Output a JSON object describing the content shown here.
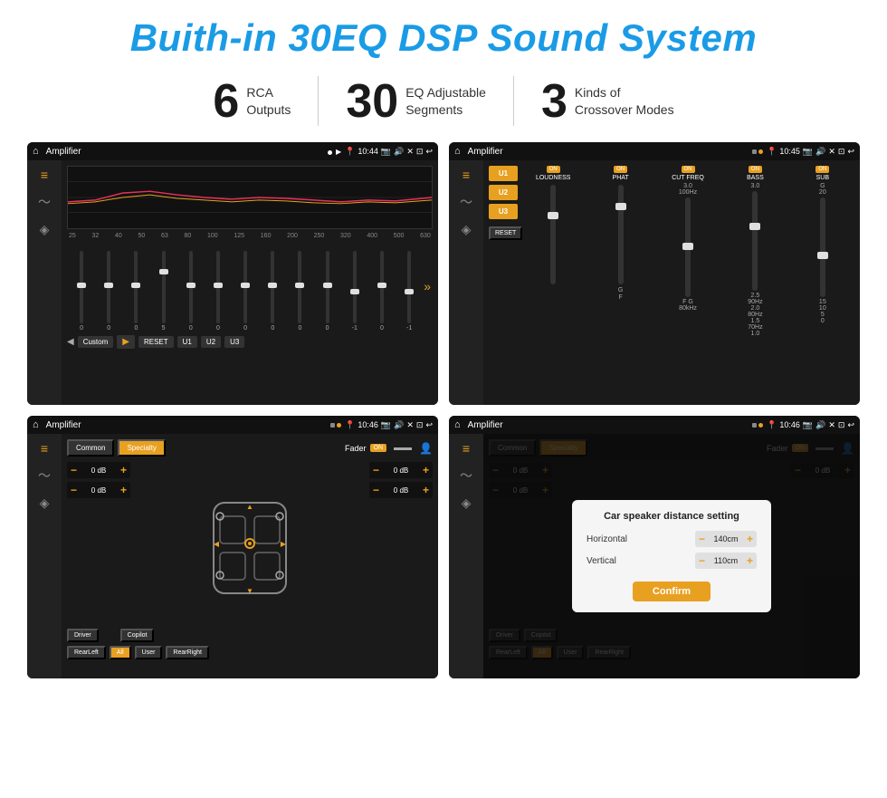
{
  "page": {
    "title": "Buith-in 30EQ DSP Sound System",
    "stats": [
      {
        "number": "6",
        "text_line1": "RCA",
        "text_line2": "Outputs"
      },
      {
        "number": "30",
        "text_line1": "EQ Adjustable",
        "text_line2": "Segments"
      },
      {
        "number": "3",
        "text_line1": "Kinds of",
        "text_line2": "Crossover Modes"
      }
    ]
  },
  "screen1": {
    "title": "Amplifier",
    "time": "10:44",
    "eq_freqs": [
      "25",
      "32",
      "40",
      "50",
      "63",
      "80",
      "100",
      "125",
      "160",
      "200",
      "250",
      "320",
      "400",
      "500",
      "630"
    ],
    "eq_values": [
      "0",
      "0",
      "0",
      "5",
      "0",
      "0",
      "0",
      "0",
      "0",
      "0",
      "-1",
      "0",
      "-1"
    ],
    "eq_mode": "Custom",
    "buttons": [
      "RESET",
      "U1",
      "U2",
      "U3"
    ]
  },
  "screen2": {
    "title": "Amplifier",
    "time": "10:45",
    "presets": [
      "U1",
      "U2",
      "U3"
    ],
    "channels": [
      "LOUDNESS",
      "PHAT",
      "CUT FREQ",
      "BASS",
      "SUB"
    ],
    "on_labels": [
      "ON",
      "ON",
      "ON",
      "ON",
      "ON"
    ],
    "reset_label": "RESET"
  },
  "screen3": {
    "title": "Amplifier",
    "time": "10:46",
    "tabs": [
      "Common",
      "Specialty"
    ],
    "active_tab": "Specialty",
    "fader_label": "Fader",
    "on_label": "ON",
    "db_values": [
      "0 dB",
      "0 dB",
      "0 dB",
      "0 dB"
    ],
    "bottom_buttons": [
      "Driver",
      "",
      "Copilot",
      "RearLeft",
      "All",
      "User",
      "RearRight"
    ]
  },
  "screen4": {
    "title": "Amplifier",
    "time": "10:46",
    "tabs": [
      "Common",
      "Specialty"
    ],
    "dialog": {
      "title": "Car speaker distance setting",
      "horizontal_label": "Horizontal",
      "horizontal_value": "140cm",
      "vertical_label": "Vertical",
      "vertical_value": "110cm",
      "confirm_label": "Confirm"
    },
    "db_values": [
      "0 dB",
      "0 dB"
    ],
    "bottom_buttons": [
      "Driver",
      "Copilot",
      "RearLeft",
      "All",
      "User",
      "RearRight"
    ]
  }
}
